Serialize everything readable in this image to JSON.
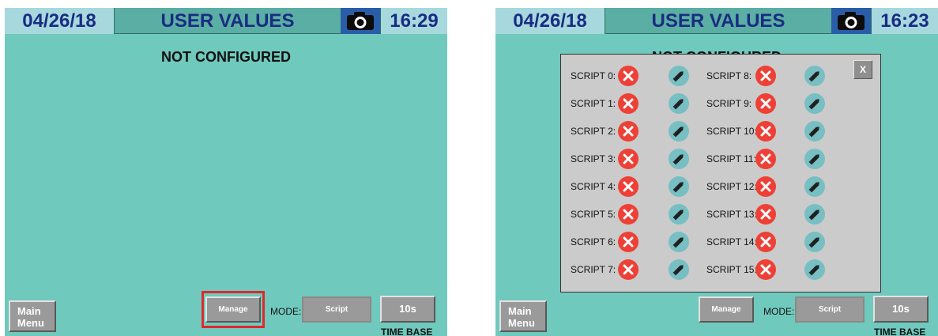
{
  "left": {
    "header": {
      "date": "04/26/18",
      "title": "USER VALUES",
      "time": "16:29",
      "camera_icon": "camera-icon"
    },
    "status": "NOT CONFIGURED",
    "buttons": {
      "main_menu_line1": "Main",
      "main_menu_line2": "Menu",
      "manage": "Manage",
      "mode_label": "MODE:",
      "mode_value": "Script",
      "time_base_value": "10s",
      "time_base_label": "TIME BASE"
    }
  },
  "right": {
    "header": {
      "date": "04/26/18",
      "title": "USER VALUES",
      "time": "16:23",
      "camera_icon": "camera-icon"
    },
    "status": "NOT CONFIGURED",
    "modal": {
      "close_label": "X",
      "scripts_left": [
        "SCRIPT 0:",
        "SCRIPT 1:",
        "SCRIPT 2:",
        "SCRIPT 3:",
        "SCRIPT 4:",
        "SCRIPT 5:",
        "SCRIPT 6:",
        "SCRIPT 7:"
      ],
      "scripts_right": [
        "SCRIPT 8:",
        "SCRIPT 9:",
        "SCRIPT 10:",
        "SCRIPT 11:",
        "SCRIPT 12:",
        "SCRIPT 13:",
        "SCRIPT 14:",
        "SCRIPT 15:"
      ],
      "delete_icon": "x-circle-icon",
      "edit_icon": "pencil-icon"
    },
    "buttons": {
      "main_menu_line1": "Main",
      "main_menu_line2": "Menu",
      "manage": "Manage",
      "mode_label": "MODE:",
      "mode_value": "Script",
      "time_base_value": "10s",
      "time_base_label": "TIME BASE"
    }
  },
  "colors": {
    "background": "#70c9bd",
    "header_text": "#1a2c82",
    "highlight": "#e0282e",
    "delete": "#ee4036",
    "edit": "#77bfc3"
  }
}
